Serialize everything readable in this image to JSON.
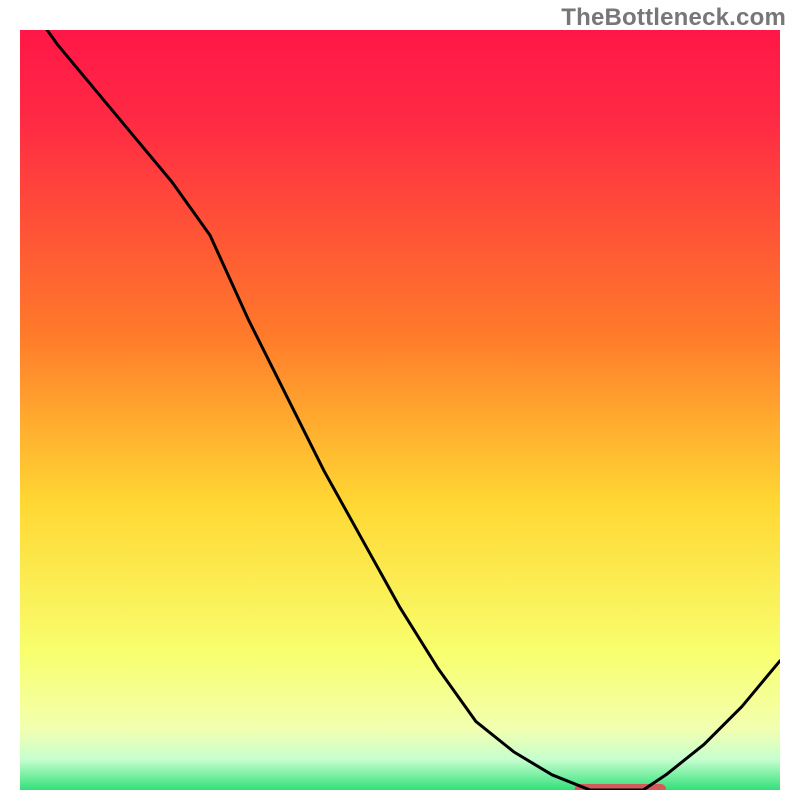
{
  "attribution": "TheBottleneck.com",
  "colors": {
    "top": "#ff1747",
    "mid1": "#ff7a2a",
    "mid2": "#ffd733",
    "mid3": "#f8ff6e",
    "bottom": "#33e07a",
    "curve": "#000000",
    "valley_marker": "#d25a5a"
  },
  "chart_data": {
    "type": "line",
    "title": "",
    "xlabel": "",
    "ylabel": "",
    "xlim": [
      0,
      100
    ],
    "ylim": [
      0,
      100
    ],
    "x": [
      0,
      5,
      10,
      15,
      20,
      25,
      30,
      35,
      40,
      45,
      50,
      55,
      60,
      65,
      70,
      75,
      80,
      82,
      85,
      90,
      95,
      100
    ],
    "values": [
      105,
      98,
      92,
      86,
      80,
      73,
      62,
      52,
      42,
      33,
      24,
      16,
      9,
      5,
      2,
      0,
      0,
      0,
      2,
      6,
      11,
      17
    ],
    "series": [
      {
        "name": "bottleneck-curve",
        "x": [
          0,
          5,
          10,
          15,
          20,
          25,
          30,
          35,
          40,
          45,
          50,
          55,
          60,
          65,
          70,
          75,
          80,
          82,
          85,
          90,
          95,
          100
        ],
        "y": [
          105,
          98,
          92,
          86,
          80,
          73,
          62,
          52,
          42,
          33,
          24,
          16,
          9,
          5,
          2,
          0,
          0,
          0,
          2,
          6,
          11,
          17
        ]
      }
    ],
    "valley_marker": {
      "x0": 73,
      "x1": 85,
      "y": 0
    },
    "grid": false,
    "legend": false
  }
}
